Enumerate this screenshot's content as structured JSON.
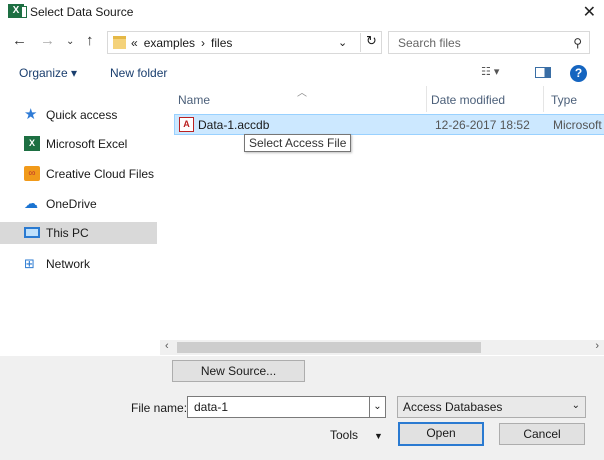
{
  "window": {
    "title": "Select Data Source",
    "app_icon": "excel-icon"
  },
  "nav": {
    "breadcrumb_prefix": "«",
    "path": [
      "examples",
      "files"
    ],
    "path_separator": "›",
    "search_placeholder": "Search files"
  },
  "toolbar": {
    "organize_label": "Organize ▾",
    "new_folder_label": "New folder"
  },
  "sidebar": {
    "items": [
      {
        "label": "Quick access",
        "icon": "star-icon"
      },
      {
        "label": "Microsoft Excel",
        "icon": "excel-icon"
      },
      {
        "label": "Creative Cloud Files",
        "icon": "creative-cloud-icon"
      },
      {
        "label": "OneDrive",
        "icon": "cloud-icon"
      },
      {
        "label": "This PC",
        "icon": "computer-icon",
        "selected": true
      },
      {
        "label": "Network",
        "icon": "network-icon"
      }
    ]
  },
  "file_list": {
    "columns": [
      "Name",
      "Date modified",
      "Type"
    ],
    "rows": [
      {
        "name": "Data-1.accdb",
        "date": "12-26-2017 18:52",
        "type": "Microsoft",
        "icon": "access-file-icon",
        "selected": true
      }
    ],
    "tooltip": "Select Access File"
  },
  "footer": {
    "new_source_label": "New Source...",
    "file_name_label": "File name:",
    "file_name_value": "data-1",
    "file_type_value": "Access Databases",
    "tools_label": "Tools",
    "open_label": "Open",
    "cancel_label": "Cancel"
  },
  "colors": {
    "accent": "#2a7ad1",
    "selection": "#cce8ff",
    "excel_green": "#1d6f42",
    "help_blue": "#1565c0"
  }
}
